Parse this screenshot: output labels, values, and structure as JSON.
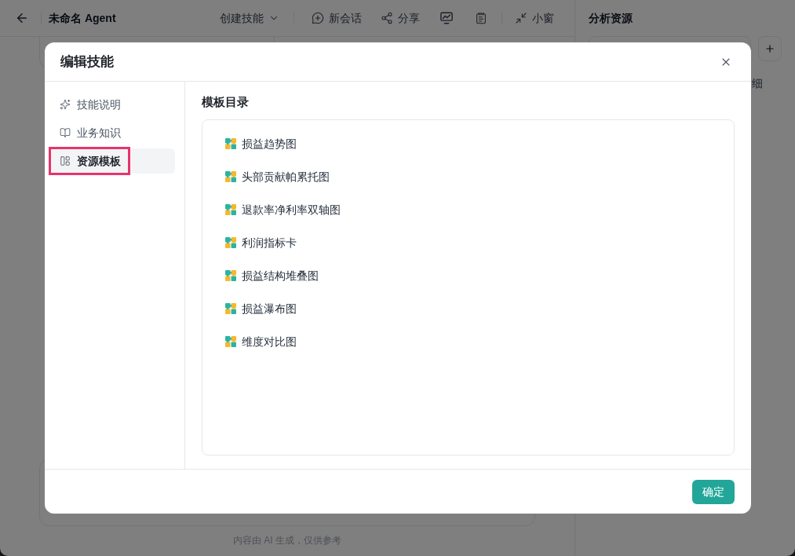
{
  "header": {
    "title": "未命名 Agent",
    "skill_menu": "创建技能",
    "toolbar": [
      {
        "kind": "new-chat",
        "label": "新会话"
      },
      {
        "kind": "share",
        "label": "分享"
      },
      {
        "kind": "monitor"
      },
      {
        "kind": "notes"
      },
      {
        "kind": "mini-window",
        "label": "小窗"
      }
    ]
  },
  "right_panel": {
    "title": "分析资源",
    "row_text": "细"
  },
  "footer_note": "内容由 AI 生成，仅供参考",
  "dialog": {
    "title": "编辑技能",
    "nav": [
      {
        "kind": "description",
        "label": "技能说明",
        "selected": false,
        "highlighted": false
      },
      {
        "kind": "knowledge",
        "label": "业务知识",
        "selected": false,
        "highlighted": false
      },
      {
        "kind": "templates",
        "label": "资源模板",
        "selected": true,
        "highlighted": true
      }
    ],
    "section_title": "模板目录",
    "templates": [
      "损益趋势图",
      "头部贡献帕累托图",
      "退款率净利率双轴图",
      "利润指标卡",
      "损益结构堆叠图",
      "损益瀑布图",
      "维度对比图"
    ],
    "confirm": "确定"
  }
}
